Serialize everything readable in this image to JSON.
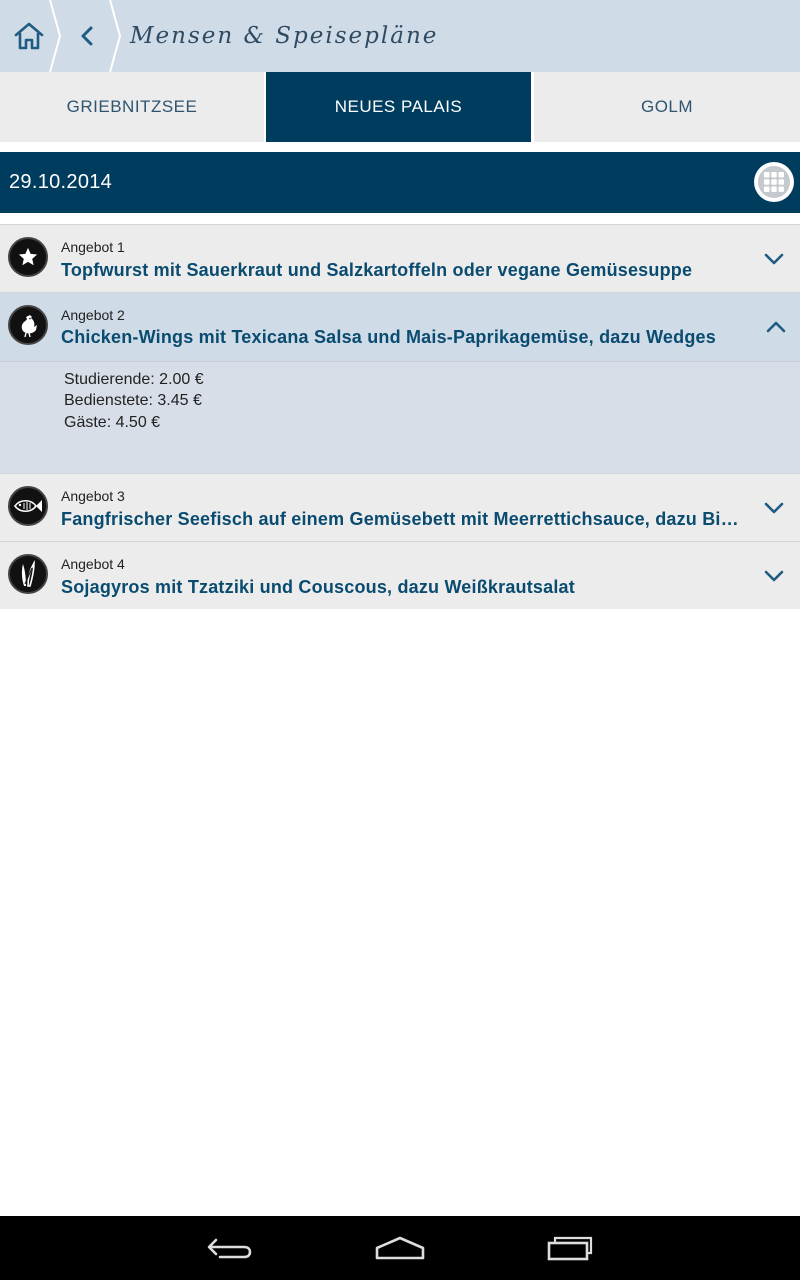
{
  "header": {
    "title": "Mensen & Speisepläne",
    "home_icon": "home-icon",
    "back_icon": "back-chevron-icon",
    "bg_color": "#cfdbe6"
  },
  "tabs": [
    {
      "label": "GRIEBNITZSEE",
      "active": false
    },
    {
      "label": "NEUES PALAIS",
      "active": true
    },
    {
      "label": "GOLM",
      "active": false
    }
  ],
  "date_bar": {
    "date": "29.10.2014",
    "calendar_icon": "calendar-grid-icon",
    "bg_color": "#003c5e"
  },
  "offers": [
    {
      "label": "Angebot 1",
      "dish": "Topfwurst mit Sauerkraut und Salzkartoffeln oder vegane Gemüsesuppe",
      "icon": "star-icon",
      "expanded": false
    },
    {
      "label": "Angebot 2",
      "dish": "Chicken-Wings mit Texicana Salsa und Mais-Paprikagemüse, dazu Wedges",
      "icon": "rooster-icon",
      "expanded": true,
      "prices": [
        "Studierende: 2.00 €",
        "Bedienstete: 3.45 €",
        "Gäste: 4.50 €"
      ]
    },
    {
      "label": "Angebot 3",
      "dish": "Fangfrischer Seefisch auf einem Gemüsebett mit Meerrettichsauce, dazu Bi…",
      "icon": "fish-icon",
      "expanded": false
    },
    {
      "label": "Angebot 4",
      "dish": "Sojagyros mit Tzatziki und Couscous, dazu Weißkrautsalat",
      "icon": "vegetable-icon",
      "expanded": false
    }
  ],
  "navbar": {
    "back_icon": "nav-back-icon",
    "home_icon": "nav-home-icon",
    "recents_icon": "nav-recents-icon"
  },
  "colors": {
    "accent": "#003c5e",
    "dish_text": "#0a4b70",
    "tab_inactive_bg": "#ececec",
    "expanded_bg": "#d8dee8"
  }
}
